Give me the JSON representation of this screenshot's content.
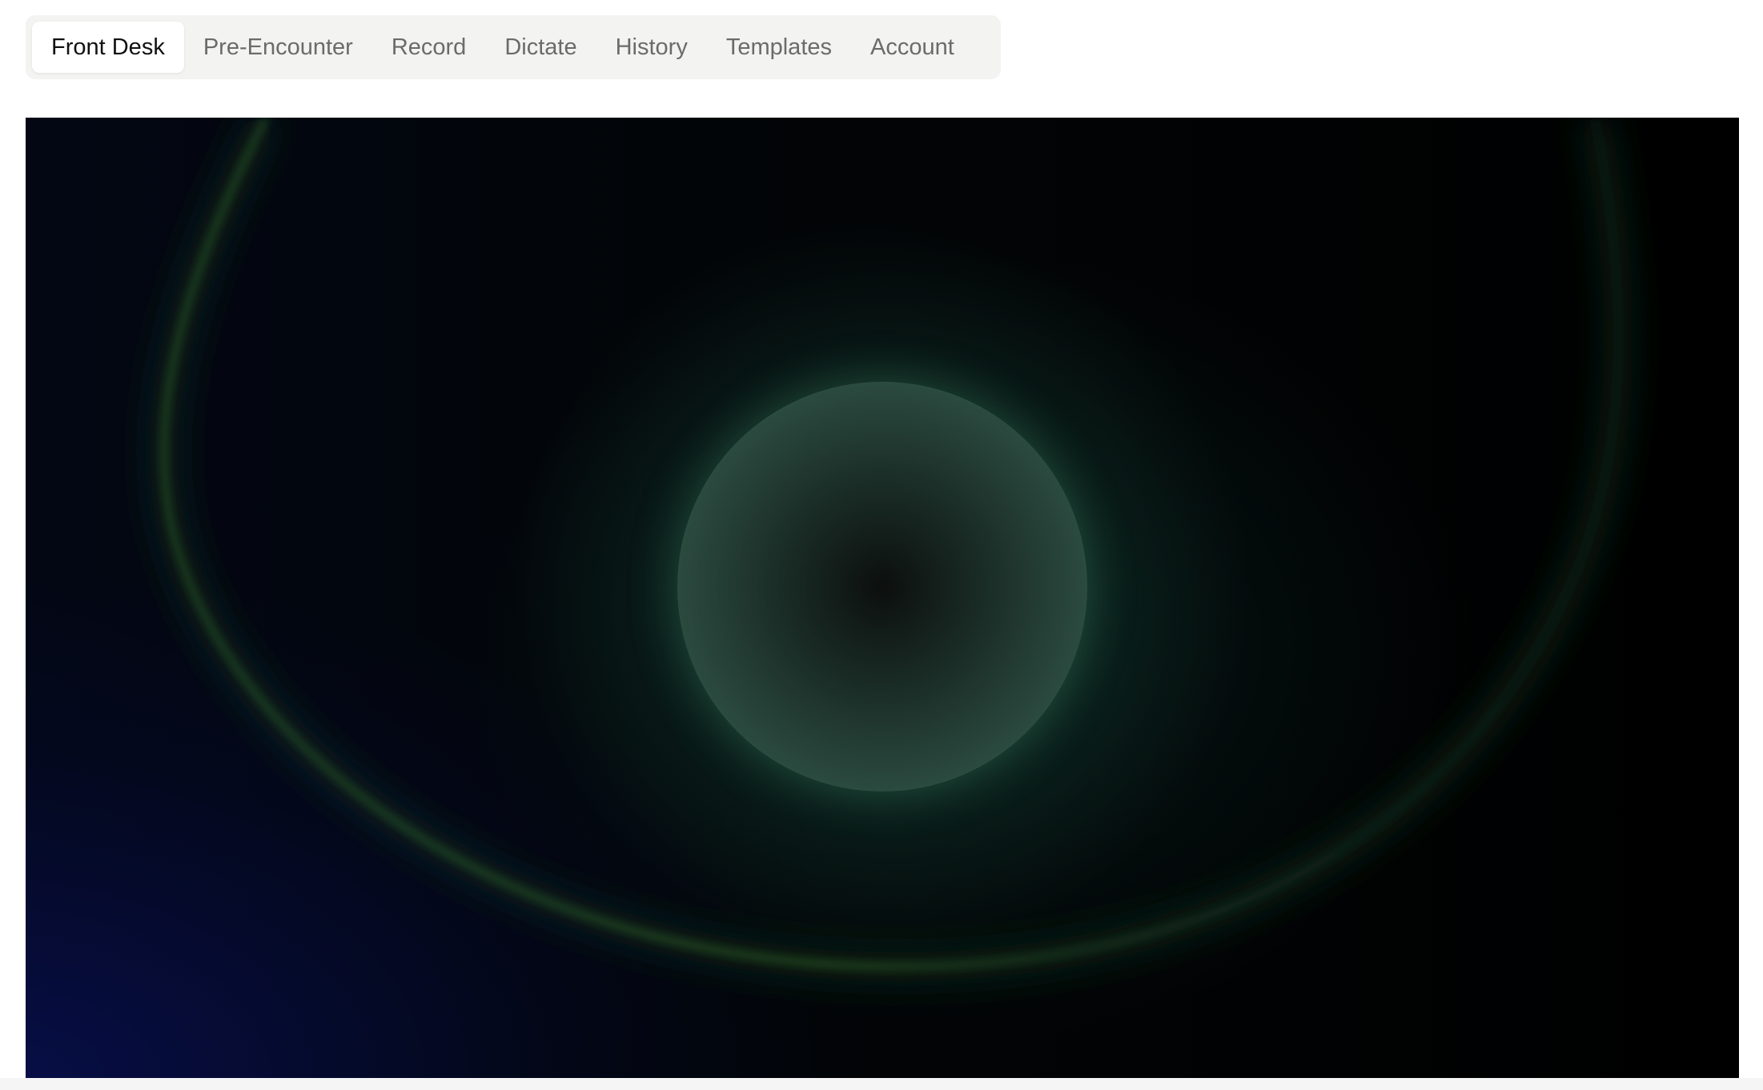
{
  "tabs": [
    {
      "label": "Front Desk",
      "active": true
    },
    {
      "label": "Pre-Encounter",
      "active": false
    },
    {
      "label": "Record",
      "active": false
    },
    {
      "label": "Dictate",
      "active": false
    },
    {
      "label": "History",
      "active": false
    },
    {
      "label": "Templates",
      "active": false
    },
    {
      "label": "Account",
      "active": false
    }
  ],
  "visual": {
    "orb_color": "#5ea687",
    "arc_color": "#2f6b2a",
    "background_color": "#000000"
  }
}
